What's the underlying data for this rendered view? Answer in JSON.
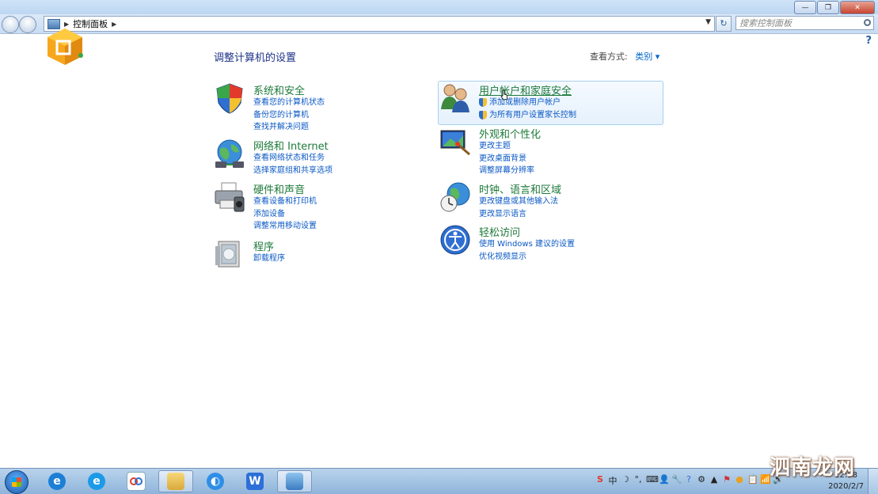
{
  "window": {
    "minimize_label": "—",
    "maximize_label": "❐",
    "close_label": "✕"
  },
  "nav": {
    "back_icon": "back-arrow-icon",
    "forward_icon": "forward-arrow-icon",
    "breadcrumb": "控制面板",
    "search_placeholder": "搜索控制面板",
    "help": "?"
  },
  "header": {
    "title": "调整计算机的设置",
    "view_by_label": "查看方式:",
    "view_by_value": "类别 ▾"
  },
  "categories": [
    {
      "title": "系统和安全",
      "icon": "shield-icon",
      "links": [
        "查看您的计算机状态",
        "备份您的计算机",
        "查找并解决问题"
      ]
    },
    {
      "title": "网络和 Internet",
      "icon": "network-globe-icon",
      "links": [
        "查看网络状态和任务",
        "选择家庭组和共享选项"
      ]
    },
    {
      "title": "硬件和声音",
      "icon": "printer-icon",
      "links": [
        "查看设备和打印机",
        "添加设备",
        "调整常用移动设置"
      ]
    },
    {
      "title": "程序",
      "icon": "programs-box-icon",
      "links": [
        "卸载程序"
      ]
    },
    {
      "title": "用户帐户和家庭安全",
      "icon": "users-icon",
      "links": [
        "添加或删除用户帐户",
        "为所有用户设置家长控制"
      ]
    },
    {
      "title": "外观和个性化",
      "icon": "display-paint-icon",
      "links": [
        "更改主题",
        "更改桌面背景",
        "调整屏幕分辨率"
      ]
    },
    {
      "title": "时钟、语言和区域",
      "icon": "globe-clock-icon",
      "links": [
        "更改键盘或其他输入法",
        "更改显示语言"
      ]
    },
    {
      "title": "轻松访问",
      "icon": "ease-of-access-icon",
      "links": [
        "使用 Windows 建议的设置",
        "优化视频显示"
      ]
    }
  ],
  "taskbar": {
    "items": [
      "ie-icon",
      "ie-icon",
      "baidu-netdisk-icon",
      "file-explorer-icon",
      "browser-icon",
      "wps-icon",
      "control-panel-icon"
    ],
    "tray_glyphs": [
      "S",
      "中",
      "☽",
      "°,",
      "⌨",
      "👤",
      "🔧",
      "?",
      "⚙",
      "▲",
      "⚑",
      "●",
      "📋",
      "📶",
      "🔊"
    ],
    "time": "12:58",
    "date": "2020/2/7"
  },
  "watermark": "泗南龙网",
  "colors": {
    "category_title": "#1e7a3a",
    "link": "#0b58c4",
    "heading": "#1e3287"
  }
}
